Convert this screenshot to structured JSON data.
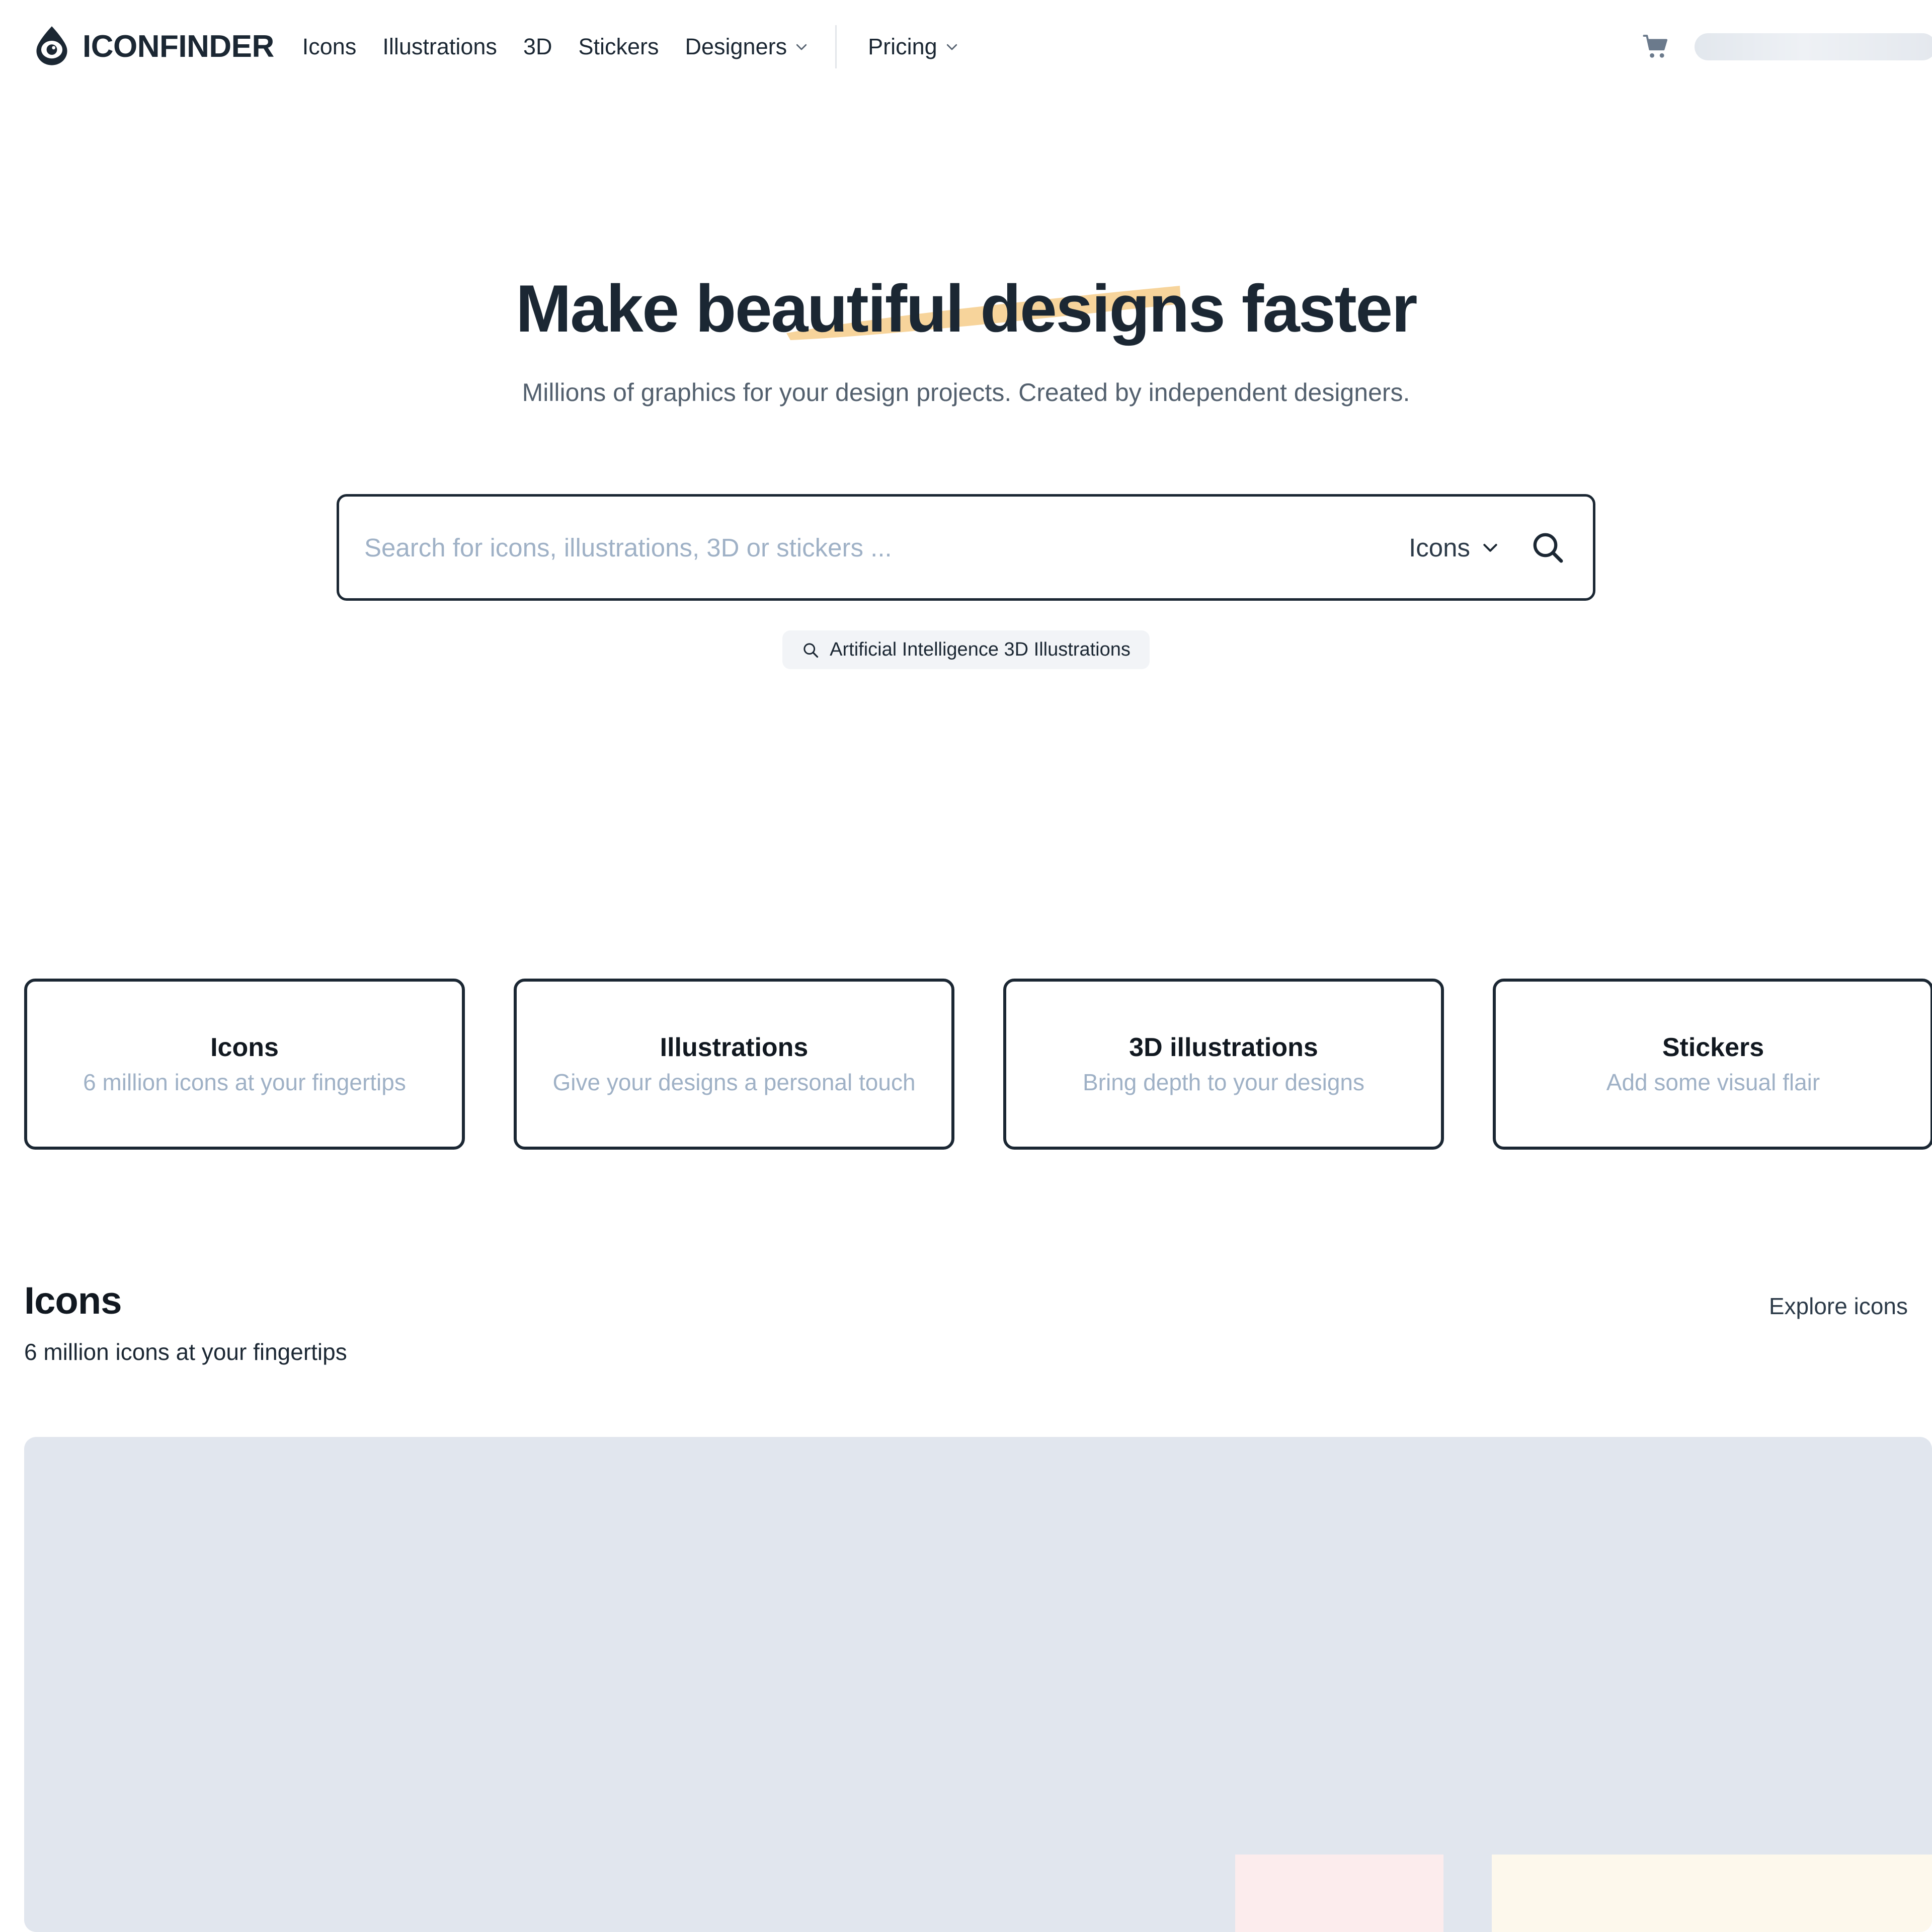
{
  "brand": {
    "name": "ICONFINDER",
    "logo_icon": "iconfinder-eye-logo",
    "logo_color": "#1b2733"
  },
  "header": {
    "nav": [
      {
        "label": "Icons",
        "icon": null
      },
      {
        "label": "Illustrations",
        "icon": null
      },
      {
        "label": "3D",
        "icon": null
      },
      {
        "label": "Stickers",
        "icon": null
      },
      {
        "label": "Designers",
        "icon": "chevron-down-icon"
      }
    ],
    "nav_secondary": [
      {
        "label": "Pricing",
        "icon": "chevron-down-icon"
      }
    ],
    "cart_icon": "shopping-cart-icon",
    "account_placeholder_loading": true
  },
  "hero": {
    "title": "Make beautiful designs faster",
    "title_before_highlight": "Make ",
    "title_highlighted": "beautiful designs",
    "title_after_highlight": " faster",
    "highlight_color": "#f7d49b",
    "subtitle": "Millions of graphics for your design projects. Created by independent designers."
  },
  "search": {
    "placeholder": "Search for icons, illustrations, 3D or stickers ...",
    "value": "",
    "type_selected": "Icons",
    "type_chevron_icon": "chevron-down-icon",
    "submit_icon": "search-icon"
  },
  "suggestion": {
    "icon": "search-icon",
    "label": "Artificial Intelligence 3D Illustrations"
  },
  "category_cards": [
    {
      "title": "Icons",
      "subtitle": "6 million icons at your fingertips"
    },
    {
      "title": "Illustrations",
      "subtitle": "Give your designs a personal touch"
    },
    {
      "title": "3D illustrations",
      "subtitle": "Bring depth to your designs"
    },
    {
      "title": "Stickers",
      "subtitle": "Add some visual flair"
    }
  ],
  "icons_section": {
    "title": "Icons",
    "subtitle": "6 million icons at your fingertips",
    "explore_label": "Explore icons",
    "content_loading": true,
    "placeholder_color": "#e1e6ee",
    "placeholder_swatches": [
      "#fceced",
      "#fdf8ec"
    ]
  }
}
